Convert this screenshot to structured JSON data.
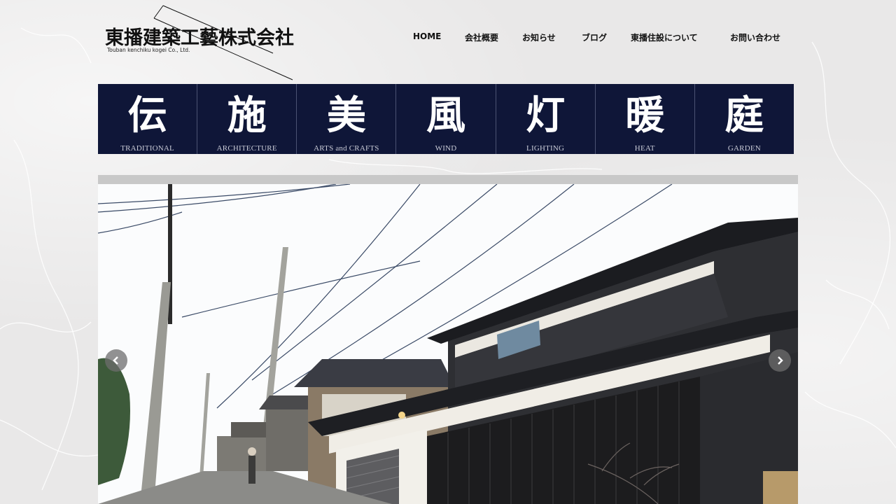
{
  "logo": {
    "title": "東播建築工藝株式会社",
    "subtitle": "Touban kenchiku kogei Co., Ltd."
  },
  "nav": [
    {
      "label": "HOME"
    },
    {
      "label": "会社概要"
    },
    {
      "label": "お知らせ"
    },
    {
      "label": "ブログ"
    },
    {
      "label": "東播住設について"
    },
    {
      "label": "お問い合わせ"
    }
  ],
  "categories": [
    {
      "kanji": "伝",
      "en": "TRADITIONAL"
    },
    {
      "kanji": "施",
      "en": "ARCHITECTURE"
    },
    {
      "kanji": "美",
      "en": "ARTS and CRAFTS"
    },
    {
      "kanji": "風",
      "en": "WIND"
    },
    {
      "kanji": "灯",
      "en": "LIGHTING"
    },
    {
      "kanji": "暖",
      "en": "HEAT"
    },
    {
      "kanji": "庭",
      "en": "GARDEN"
    }
  ],
  "slider": {
    "prev_icon": "chevron-left-icon",
    "next_icon": "chevron-right-icon"
  },
  "colors": {
    "category_bar": "#0f1638",
    "slider_frame": "#c8c8c8"
  }
}
